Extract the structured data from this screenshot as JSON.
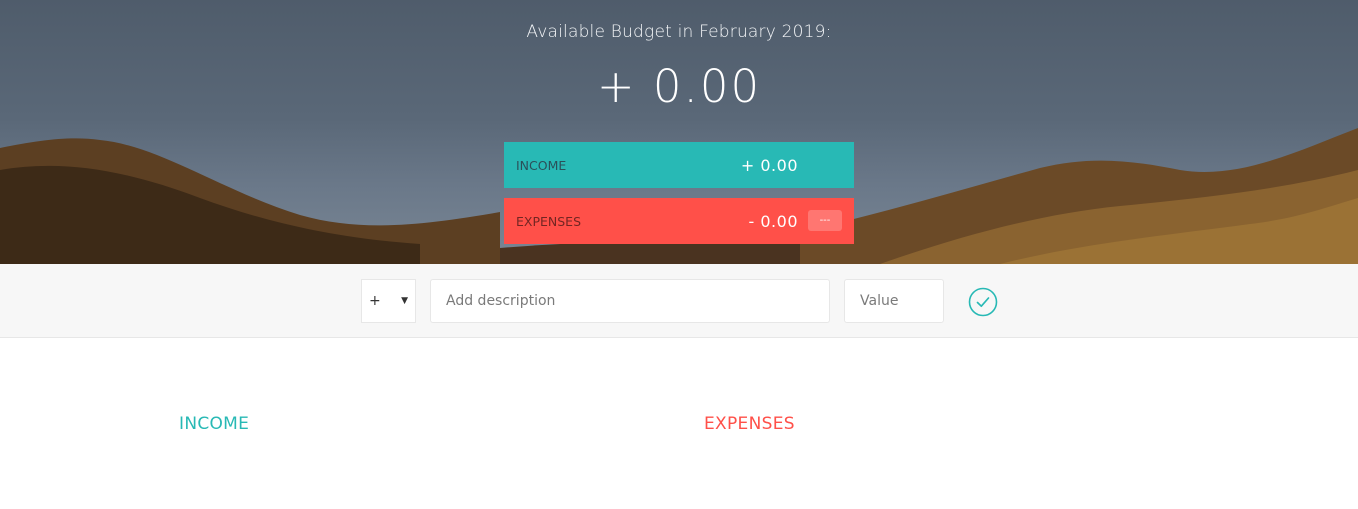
{
  "budget": {
    "title": "Available Budget in February 2019:",
    "value": "+ 0.00",
    "income": {
      "label": "Income",
      "value": "+ 0.00"
    },
    "expenses": {
      "label": "Expenses",
      "value": "- 0.00",
      "percentage": "---"
    }
  },
  "add_form": {
    "type_selected": "+",
    "description_placeholder": "Add description",
    "value_placeholder": "Value",
    "submit_icon": "checkmark-circle-icon"
  },
  "lists": {
    "income_title": "Income",
    "expenses_title": "Expenses"
  },
  "colors": {
    "income": "#28b9b5",
    "expenses": "#ff5049",
    "add_bar": "#f7f7f7"
  }
}
